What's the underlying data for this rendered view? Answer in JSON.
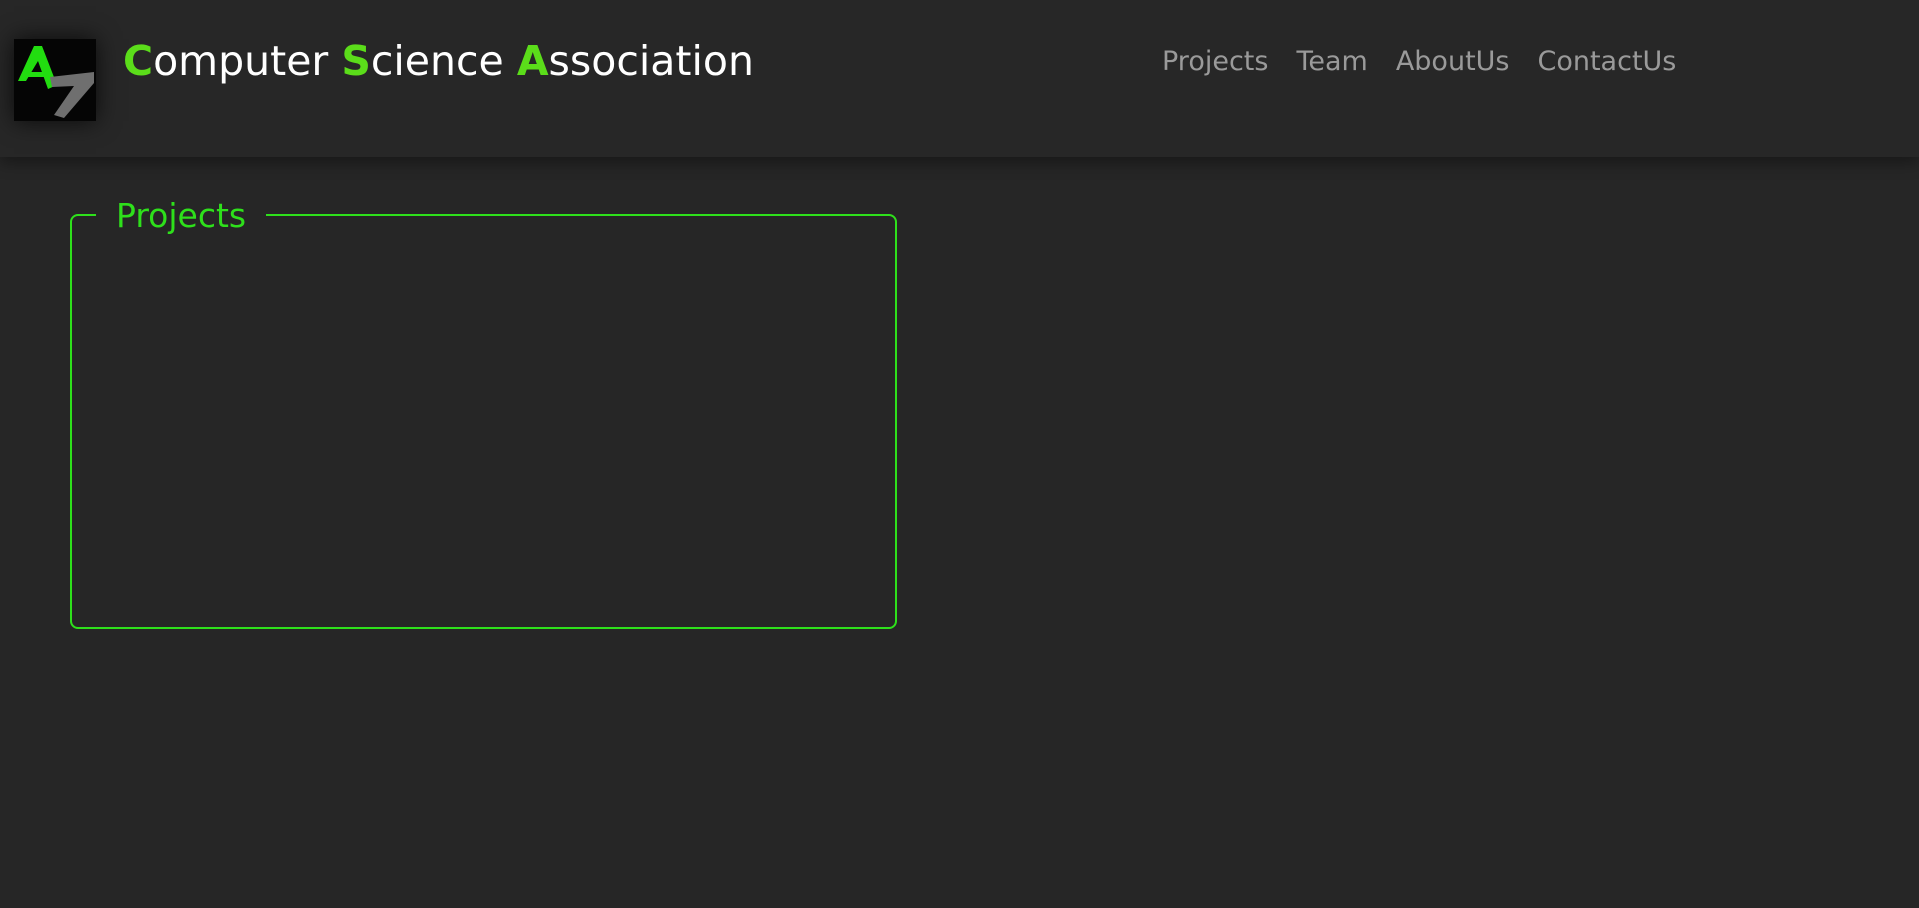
{
  "header": {
    "logo": {
      "icon": "csa-logo-icon"
    },
    "title_parts": [
      {
        "accent": "C",
        "rest": "omputer "
      },
      {
        "accent": "S",
        "rest": "cience "
      },
      {
        "accent": "A",
        "rest": "ssociation"
      }
    ],
    "nav": [
      {
        "label": "Projects"
      },
      {
        "label": "Team"
      },
      {
        "label": "AboutUs"
      },
      {
        "label": "ContactUs"
      }
    ]
  },
  "main": {
    "projects_section": {
      "title": "Projects"
    }
  },
  "colors": {
    "background": "#262626",
    "accent_green": "#5bdd1a",
    "border_green": "#2ee01b",
    "nav_text": "#9a9a9a",
    "title_text": "#ffffff"
  }
}
